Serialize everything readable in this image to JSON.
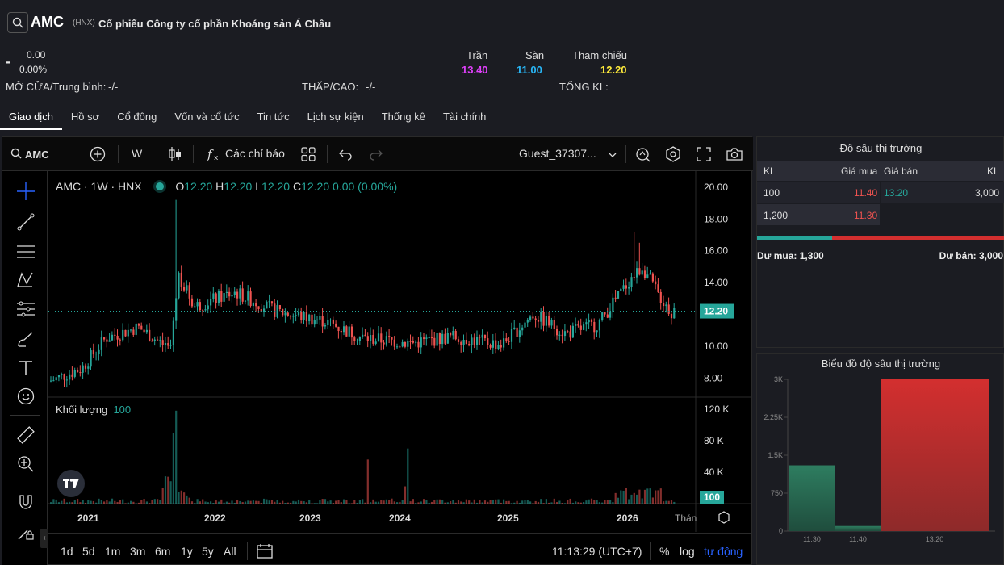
{
  "header": {
    "symbol": "AMC",
    "exchange": "(HNX)",
    "company": "Cổ phiếu Công ty cổ phần Khoáng sản Á Châu",
    "price": "-",
    "change": "0.00",
    "change_pct": "0.00%",
    "ceiling_label": "Trần",
    "ceiling": "13.40",
    "floor_label": "Sàn",
    "floor": "11.00",
    "ref_label": "Tham chiếu",
    "ref": "12.20",
    "open_label": "MỞ CỬA/Trung bình:",
    "open_val": "-/-",
    "lowhigh_label": "THẤP/CAO:",
    "lowhigh_val": "-/-",
    "volume_label": "TỔNG KL:",
    "colors": {
      "ceiling": "#e040fb",
      "floor": "#29b6f6",
      "ref": "#ffeb3b"
    }
  },
  "tabs": [
    "Giao dịch",
    "Hồ sơ",
    "Cổ đông",
    "Vốn và cổ tức",
    "Tin tức",
    "Lịch sự kiện",
    "Thống kê",
    "Tài chính"
  ],
  "toolbar": {
    "symbol": "AMC",
    "interval": "W",
    "indicators": "Các chỉ báo",
    "user": "Guest_37307..."
  },
  "legend": {
    "title": "AMC · 1W · HNX",
    "o_label": "O",
    "o": "12.20",
    "h_label": "H",
    "h": "12.20",
    "l_label": "L",
    "l": "12.20",
    "c_label": "C",
    "c": "12.20",
    "change": "0.00 (0.00%)",
    "volume_label": "Khối lượng",
    "volume": "100"
  },
  "bottombar": {
    "ranges": [
      "1d",
      "5d",
      "1m",
      "3m",
      "6m",
      "1y",
      "5y",
      "All"
    ],
    "time": "11:13:29 (UTC+7)",
    "pct": "%",
    "log": "log",
    "auto": "tự động"
  },
  "chart_data": {
    "type": "candlestick",
    "price_axis": [
      "20.00",
      "18.00",
      "16.00",
      "14.00",
      "12.00",
      "10.00",
      "8.00"
    ],
    "last_price": "12.20",
    "volume_axis": [
      "120 K",
      "80 K",
      "40 K"
    ],
    "last_volume": "100",
    "x_ticks": [
      "2021",
      "2022",
      "2023",
      "2024",
      "2025",
      "2026",
      "Thán"
    ],
    "ylim": [
      7,
      20.5
    ],
    "vol_lim": [
      0,
      125000
    ]
  },
  "orderbook": {
    "title": "Độ sâu thị trường",
    "headers": [
      "KL",
      "Giá mua",
      "Giá bán",
      "KL"
    ],
    "bids": [
      {
        "vol": "100",
        "price": "11.40"
      },
      {
        "vol": "1,200",
        "price": "11.30"
      }
    ],
    "asks": [
      {
        "vol": "3,000",
        "price": "13.20"
      }
    ],
    "bid_total": "Dư mua: 1,300",
    "ask_total": "Dư bán: 3,000"
  },
  "depth_chart": {
    "title": "Biểu đồ độ sâu thị trường",
    "y_ticks": [
      "3K",
      "2.25K",
      "1.5K",
      "750",
      "0"
    ],
    "x_labels": [
      "11.30",
      "11.40",
      "13.20"
    ],
    "bars": [
      {
        "price": "11.30",
        "value": 1300,
        "side": "bid"
      },
      {
        "price": "11.40",
        "value": 100,
        "side": "bid"
      },
      {
        "price": "13.20",
        "value": 3000,
        "side": "ask"
      }
    ],
    "ylim": [
      0,
      3000
    ]
  }
}
